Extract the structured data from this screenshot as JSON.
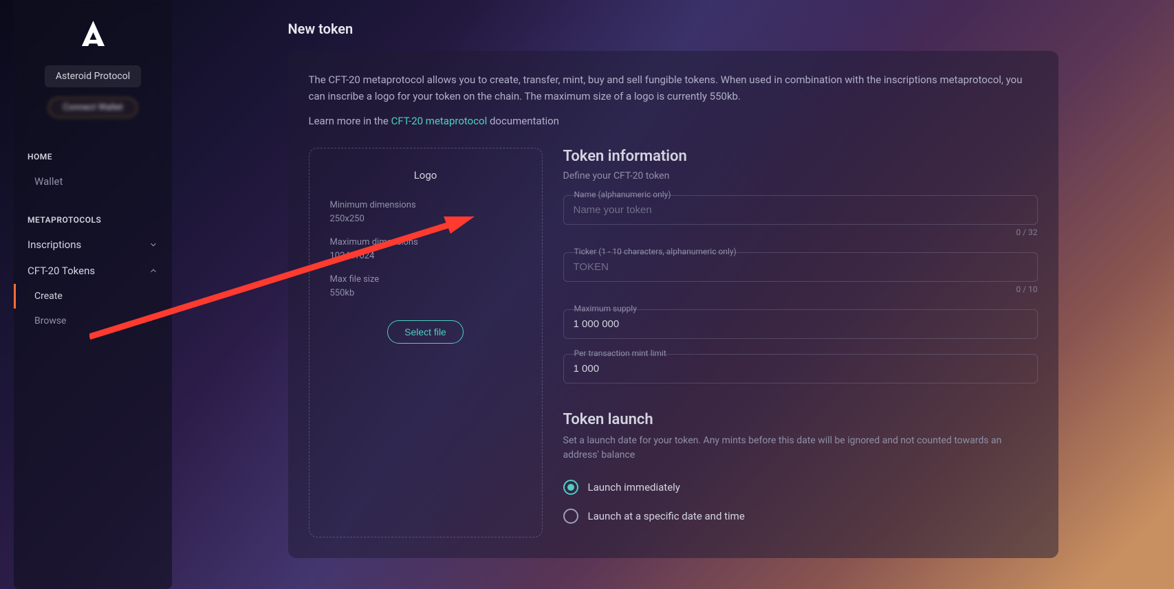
{
  "sidebar": {
    "protocol_name": "Asteroid Protocol",
    "connect_text": "Connect Wallet",
    "sections": [
      {
        "heading": "HOME",
        "items": [
          {
            "label": "Wallet",
            "name": "wallet"
          }
        ]
      },
      {
        "heading": "METAPROTOCOLS",
        "items": [
          {
            "label": "Inscriptions",
            "name": "inscriptions",
            "expandable": true,
            "expanded": false
          },
          {
            "label": "CFT-20 Tokens",
            "name": "cft20-tokens",
            "expandable": true,
            "expanded": true,
            "children": [
              {
                "label": "Create",
                "name": "create",
                "active": true
              },
              {
                "label": "Browse",
                "name": "browse"
              }
            ]
          }
        ]
      }
    ]
  },
  "page": {
    "title": "New token",
    "description": "The CFT-20 metaprotocol allows you to create, transfer, mint, buy and sell fungible tokens. When used in combination with the inscriptions metaprotocol, you can inscribe a logo for your token on the chain. The maximum size of a logo is currently 550kb.",
    "learn_more_prefix": "Learn more in the ",
    "learn_more_link": "CFT-20 metaprotocol",
    "learn_more_suffix": " documentation"
  },
  "logo_upload": {
    "title": "Logo",
    "min_dim_label": "Minimum dimensions",
    "min_dim_value": "250x250",
    "max_dim_label": "Maximum dimensions",
    "max_dim_value": "1024x1024",
    "max_size_label": "Max file size",
    "max_size_value": "550kb",
    "button": "Select file"
  },
  "token_info": {
    "title": "Token information",
    "subtitle": "Define your CFT-20 token",
    "fields": {
      "name": {
        "label": "Name (alphanumeric only)",
        "placeholder": "Name your token",
        "counter": "0 / 32"
      },
      "ticker": {
        "label": "Ticker (1 - 10 characters, alphanumeric only)",
        "placeholder": "TOKEN",
        "counter": "0 / 10"
      },
      "max_supply": {
        "label": "Maximum supply",
        "value": "1 000 000"
      },
      "mint_limit": {
        "label": "Per transaction mint limit",
        "value": "1 000"
      }
    }
  },
  "launch": {
    "title": "Token launch",
    "description": "Set a launch date for your token. Any mints before this date will be ignored and not counted towards an address' balance",
    "options": [
      {
        "label": "Launch immediately",
        "selected": true
      },
      {
        "label": "Launch at a specific date and time",
        "selected": false
      }
    ]
  }
}
